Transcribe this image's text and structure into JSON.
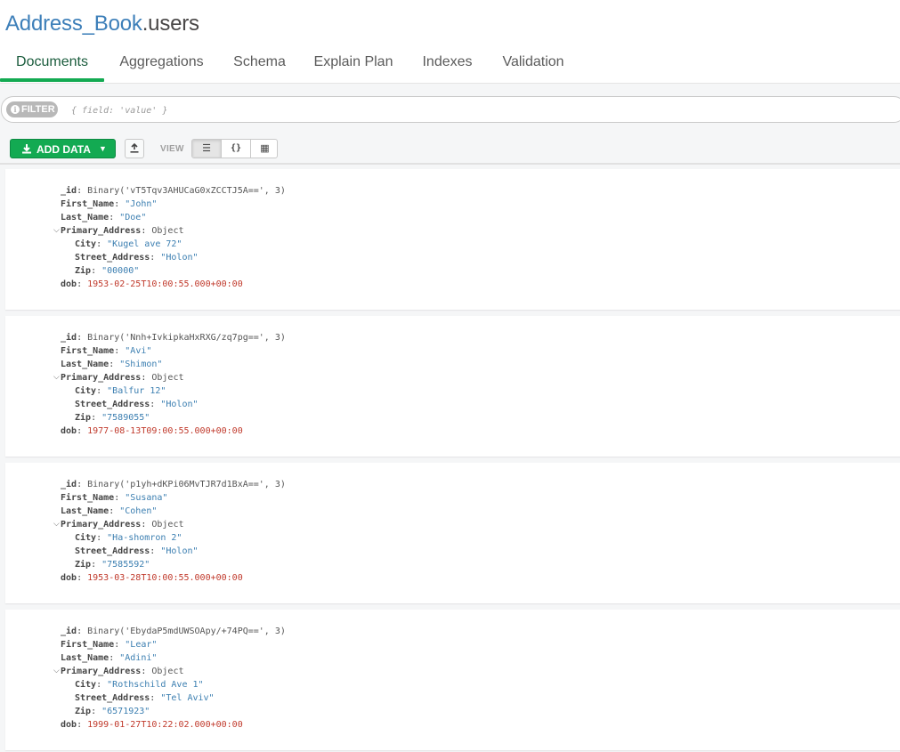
{
  "namespace": {
    "database": "Address_Book",
    "collection": ".users"
  },
  "tabs": [
    "Documents",
    "Aggregations",
    "Schema",
    "Explain Plan",
    "Indexes",
    "Validation"
  ],
  "active_tab": "Documents",
  "filter": {
    "label": "FILTER",
    "placeholder": "{ field: 'value' }",
    "value": ""
  },
  "toolbar": {
    "add_data_label": "ADD DATA",
    "view_label": "VIEW",
    "view_list_glyph": "☰",
    "view_json_glyph": "{}",
    "view_table_glyph": "▦"
  },
  "colors": {
    "accent": "#13aa52",
    "db_name": "#3d7fb9",
    "string_value": "#3c7fb1",
    "date_value": "#c0392b"
  },
  "keys": {
    "id": "_id",
    "first": "First_Name",
    "last": "Last_Name",
    "addr": "Primary_Address",
    "city": "City",
    "street": "Street_Address",
    "zip": "Zip",
    "dob": "dob"
  },
  "documents": [
    {
      "id": "Binary('vT5Tqv3AHUCaG0xZCCTJ5A==', 3)",
      "first": "\"John\"",
      "last": "\"Doe\"",
      "addr_type": "Object",
      "city": "\"Kugel ave 72\"",
      "street": "\"Holon\"",
      "zip": "\"00000\"",
      "dob": "1953-02-25T10:00:55.000+00:00"
    },
    {
      "id": "Binary('Nnh+IvkipkaHxRXG/zq7pg==', 3)",
      "first": "\"Avi\"",
      "last": "\"Shimon\"",
      "addr_type": "Object",
      "city": "\"Balfur 12\"",
      "street": "\"Holon\"",
      "zip": "\"7589055\"",
      "dob": "1977-08-13T09:00:55.000+00:00"
    },
    {
      "id": "Binary('p1yh+dKPi06MvTJR7d1BxA==', 3)",
      "first": "\"Susana\"",
      "last": "\"Cohen\"",
      "addr_type": "Object",
      "city": "\"Ha-shomron 2\"",
      "street": "\"Holon\"",
      "zip": "\"7585592\"",
      "dob": "1953-03-28T10:00:55.000+00:00"
    },
    {
      "id": "Binary('EbydaP5mdUWSOApy/+74PQ==', 3)",
      "first": "\"Lear\"",
      "last": "\"Adini\"",
      "addr_type": "Object",
      "city": "\"Rothschild Ave 1\"",
      "street": "\"Tel Aviv\"",
      "zip": "\"6571923\"",
      "dob": "1999-01-27T10:22:02.000+00:00"
    }
  ]
}
